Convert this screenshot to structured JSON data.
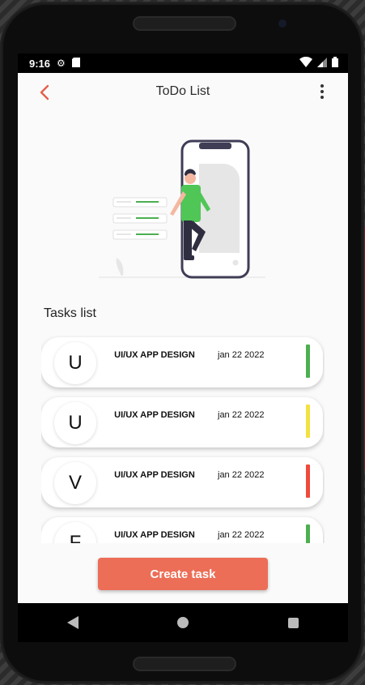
{
  "status_bar": {
    "time": "9:16"
  },
  "app_bar": {
    "title": "ToDo List"
  },
  "section": {
    "heading": "Tasks list"
  },
  "tasks": [
    {
      "initial": "U",
      "title": "UI/UX APP DESIGN",
      "date": "jan 22 2022",
      "status_color": "#4caf50"
    },
    {
      "initial": "U",
      "title": "UI/UX APP DESIGN",
      "date": "jan 22 2022",
      "status_color": "#f5e042"
    },
    {
      "initial": "V",
      "title": "UI/UX APP DESIGN",
      "date": "jan 22 2022",
      "status_color": "#f04a3c"
    },
    {
      "initial": "F",
      "title": "UI/UX APP DESIGN",
      "date": "jan 22 2022",
      "status_color": "#4caf50"
    }
  ],
  "actions": {
    "create_label": "Create task"
  },
  "colors": {
    "accent": "#ec6e57",
    "back_arrow": "#e4614b"
  },
  "icons": {
    "status": [
      "settings-icon",
      "sd-card-icon",
      "wifi-icon",
      "signal-icon",
      "battery-icon"
    ],
    "app_bar": [
      "back-arrow-icon",
      "more-vert-icon"
    ],
    "nav": [
      "nav-back-icon",
      "nav-home-icon",
      "nav-recents-icon"
    ]
  }
}
